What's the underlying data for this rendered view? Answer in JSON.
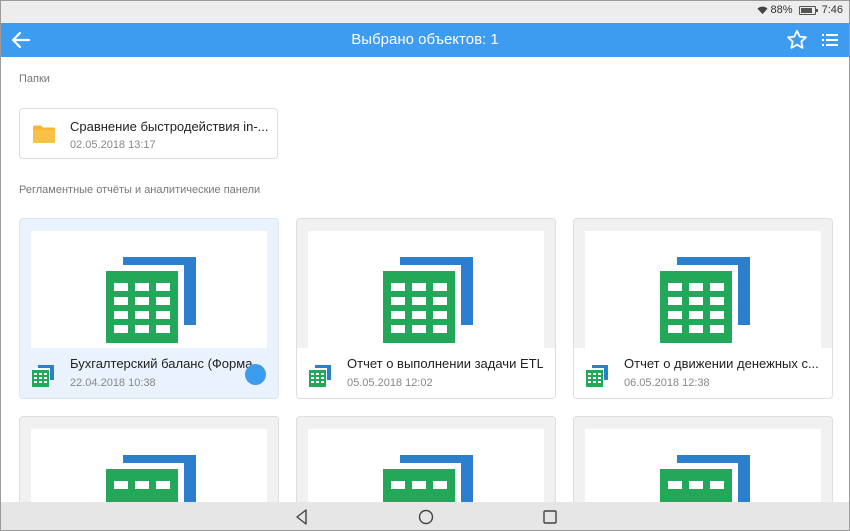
{
  "status": {
    "battery": "88%",
    "time": "7:46",
    "battery_level": 0.88
  },
  "appbar": {
    "title": "Выбрано объектов: 1"
  },
  "sections": {
    "folders": "Папки",
    "reports": "Регламентные отчёты и аналитические панели"
  },
  "folder": {
    "name": "Сравнение быстродействия in-...",
    "date": "02.05.2018 13:17"
  },
  "reports": [
    {
      "name": "Бухгалтерский баланс (Форма...",
      "date": "22.04.2018 10:38",
      "selected": true
    },
    {
      "name": "Отчет о выполнении задачи ETL",
      "date": "05.05.2018 12:02",
      "selected": false
    },
    {
      "name": "Отчет о движении денежных с...",
      "date": "06.05.2018 12:38",
      "selected": false
    }
  ],
  "colors": {
    "accent": "#3d9bf0",
    "green": "#23a85a",
    "blue": "#2b7fcc",
    "folder": "#f7b733"
  },
  "icons": [
    "back-arrow-icon",
    "star-icon",
    "list-icon",
    "folder-icon",
    "spreadsheet-icon",
    "nav-back-icon",
    "nav-home-icon",
    "nav-recents-icon"
  ]
}
